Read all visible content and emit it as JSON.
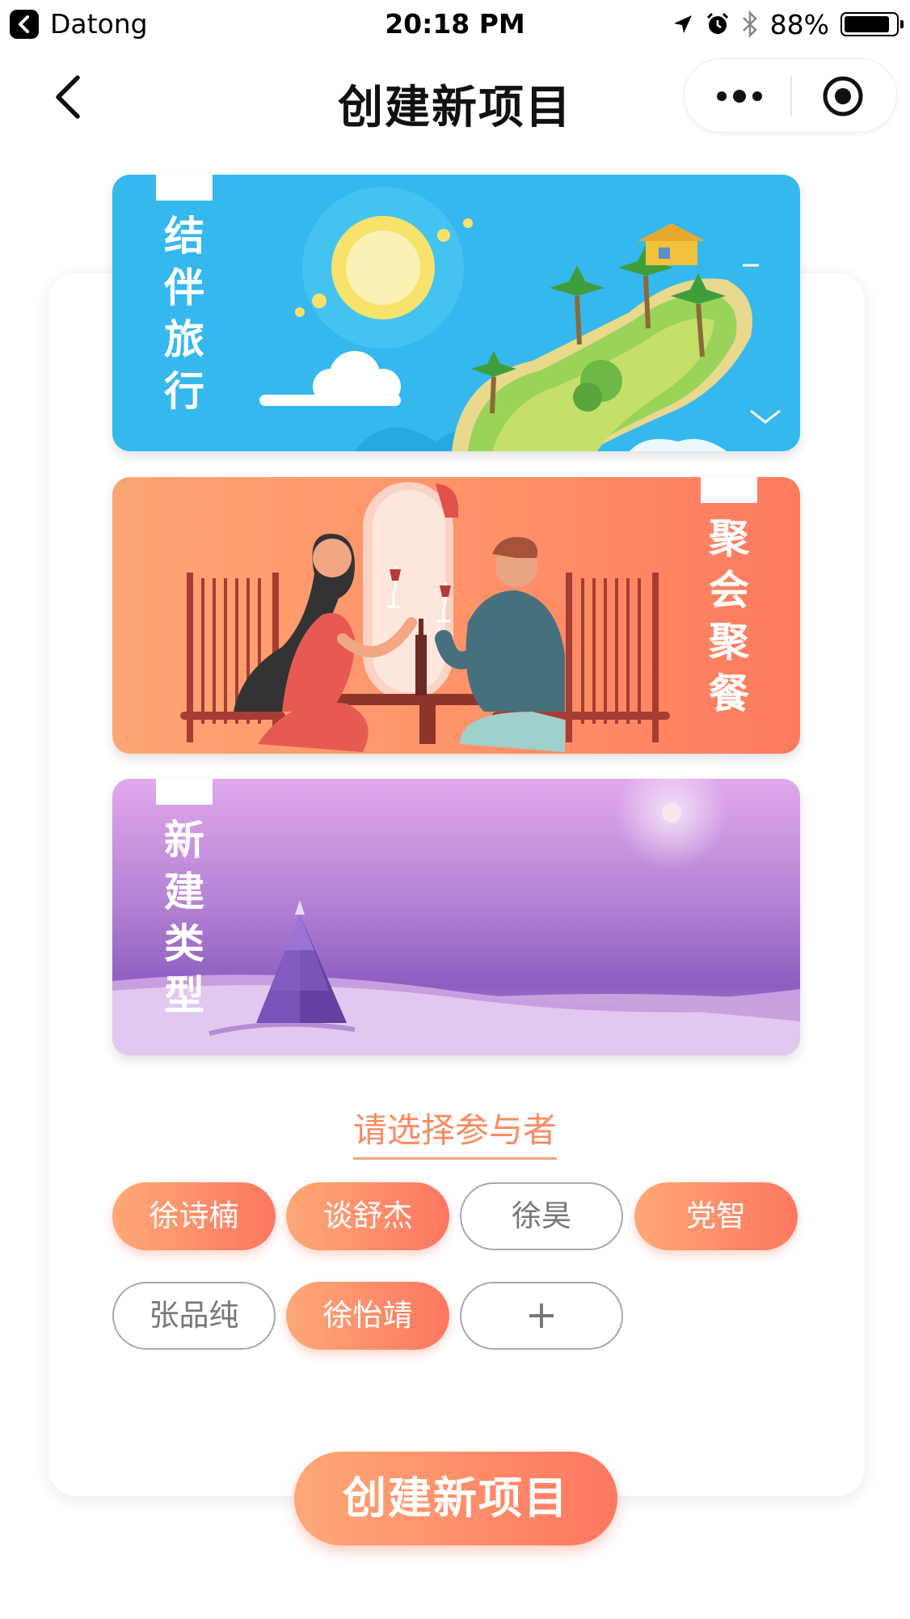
{
  "status_bar": {
    "carrier": "Datong",
    "time": "20:18 PM",
    "battery": "88%",
    "battery_level": 0.88
  },
  "nav": {
    "title": "创建新项目",
    "icons": [
      "chevron-left-icon",
      "more-dots-icon",
      "target-icon"
    ]
  },
  "cards": [
    {
      "label": "结伴旅行",
      "theme": "travel",
      "color": "#35b8ee"
    },
    {
      "label": "聚会聚餐",
      "theme": "party",
      "color": "#fd8a64"
    },
    {
      "label": "新建类型",
      "theme": "new",
      "color": "#b482d4"
    }
  ],
  "participants": {
    "title": "请选择参与者",
    "people": [
      {
        "name": "徐诗楠",
        "selected": true
      },
      {
        "name": "谈舒杰",
        "selected": true
      },
      {
        "name": "徐昊",
        "selected": false
      },
      {
        "name": "党智",
        "selected": true
      },
      {
        "name": "张品纯",
        "selected": false
      },
      {
        "name": "徐怡靖",
        "selected": true
      }
    ],
    "add_label": "+"
  },
  "create_button": "创建新项目",
  "colors": {
    "accent_start": "#fea876",
    "accent_end": "#fd7760"
  }
}
